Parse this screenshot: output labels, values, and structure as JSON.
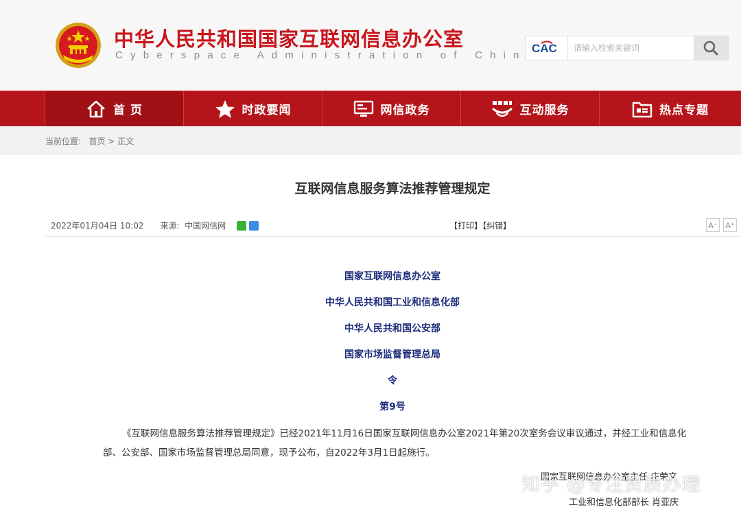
{
  "header": {
    "title": "中华人民共和国国家互联网信息办公室",
    "subtitle": "Cyberspace Administration of China",
    "logo_text": "CAC",
    "search_placeholder": "请输入检索关键词"
  },
  "nav": {
    "items": [
      {
        "label": "首 页",
        "icon": "home-icon"
      },
      {
        "label": "时政要闻",
        "icon": "star-icon"
      },
      {
        "label": "网信政务",
        "icon": "monitor-icon"
      },
      {
        "label": "互动服务",
        "icon": "interaction-icon"
      },
      {
        "label": "热点专题",
        "icon": "folder-icon"
      }
    ]
  },
  "breadcrumb": {
    "prefix": "当前位置:",
    "home": "首页",
    "separator": ">",
    "current": "正文"
  },
  "article": {
    "title": "互联网信息服务算法推荐管理规定",
    "date": "2022年01月04日 10:02",
    "source_label": "来源:",
    "source": "中国网信网",
    "print": "【打印】",
    "correct": "【纠错】",
    "font_smaller": "A⁻",
    "font_larger": "A⁺",
    "issuers": [
      "国家互联网信息办公室",
      "中华人民共和国工业和信息化部",
      "中华人民共和国公安部",
      "国家市场监督管理总局",
      "令",
      "第9号"
    ],
    "body": "《互联网信息服务算法推荐管理规定》已经2021年11月16日国家互联网信息办公室2021年第20次室务会议审议通过，并经工业和信息化部、公安部、国家市场监督管理总局同意，现予公布，自2022年3月1日起施行。",
    "sign_1": "国家互联网信息办公室主任 庄荣文",
    "sign_2": "工业和信息化部部长 肖亚庆"
  },
  "watermark": "知乎 @专注资质办理",
  "colors": {
    "brand_red": "#c8161d",
    "nav_red": "#b5141a",
    "issuer_blue": "#1c2b7a"
  }
}
